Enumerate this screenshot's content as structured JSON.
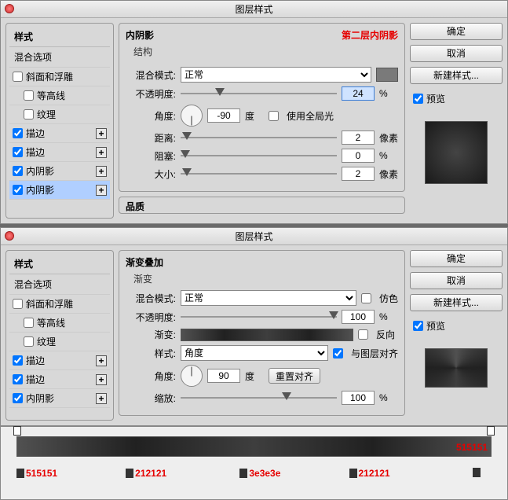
{
  "dialog_title": "图层样式",
  "panel1": {
    "styles_header": "样式",
    "blend_options": "混合选项",
    "effects": [
      {
        "label": "斜面和浮雕",
        "checked": false
      },
      {
        "label": "等高线",
        "checked": false,
        "indent": true
      },
      {
        "label": "纹理",
        "checked": false,
        "indent": true
      },
      {
        "label": "描边",
        "checked": true,
        "plus": true
      },
      {
        "label": "描边",
        "checked": true,
        "plus": true
      },
      {
        "label": "内阴影",
        "checked": true,
        "plus": true
      },
      {
        "label": "内阴影",
        "checked": true,
        "plus": true,
        "selected": true
      }
    ],
    "group_title": "内阴影",
    "structure": "结构",
    "annotation": "第二层内阴影",
    "blend_mode_label": "混合模式:",
    "blend_mode_value": "正常",
    "opacity_label": "不透明度:",
    "opacity_value": "24",
    "percent": "%",
    "angle_label": "角度:",
    "angle_value": "-90",
    "degree": "度",
    "global_light": "使用全局光",
    "distance_label": "距离:",
    "distance_value": "2",
    "px": "像素",
    "choke_label": "阻塞:",
    "choke_value": "0",
    "size_label": "大小:",
    "size_value": "2",
    "quality": "品质"
  },
  "panel2": {
    "effects": [
      {
        "label": "斜面和浮雕",
        "checked": false
      },
      {
        "label": "等高线",
        "checked": false,
        "indent": true
      },
      {
        "label": "纹理",
        "checked": false,
        "indent": true
      },
      {
        "label": "描边",
        "checked": true,
        "plus": true
      },
      {
        "label": "描边",
        "checked": true,
        "plus": true
      },
      {
        "label": "内阴影",
        "checked": true,
        "plus": true
      }
    ],
    "group_title": "渐变叠加",
    "sub": "渐变",
    "blend_mode_label": "混合模式:",
    "blend_mode_value": "正常",
    "dither": "仿色",
    "opacity_label": "不透明度:",
    "opacity_value": "100",
    "percent": "%",
    "gradient_label": "渐变:",
    "reverse": "反向",
    "style_label": "样式:",
    "style_value": "角度",
    "align": "与图层对齐",
    "angle_label": "角度:",
    "angle_value": "90",
    "degree": "度",
    "reset_align": "重置对齐",
    "scale_label": "缩放:",
    "scale_value": "100"
  },
  "buttons": {
    "ok": "确定",
    "cancel": "取消",
    "new_style": "新建样式...",
    "preview": "预览"
  },
  "gradient_stops": {
    "s1": "515151",
    "s2": "212121",
    "s3": "3e3e3e",
    "s4": "212121",
    "s5": "515151"
  }
}
